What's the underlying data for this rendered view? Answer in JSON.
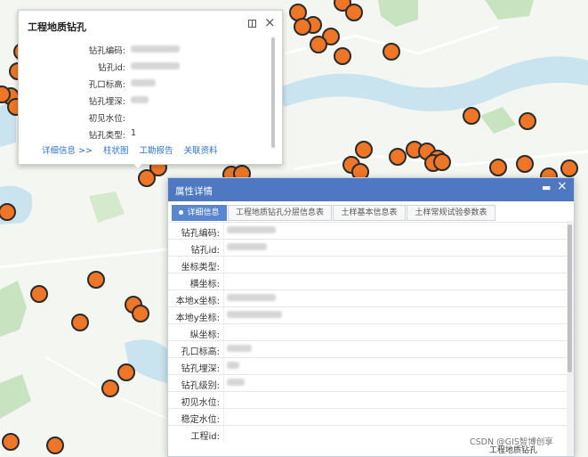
{
  "map": {
    "background": "#f4f6f2",
    "water_color": "#c9e4ee",
    "marker_color": "#ee7626",
    "marker_outline": "#2b2b2b"
  },
  "popup": {
    "title": "工程地质钻孔",
    "rows": [
      {
        "label": "钻孔编码:",
        "value": "",
        "blurred": true
      },
      {
        "label": "钻孔id:",
        "value": "",
        "blurred": true
      },
      {
        "label": "孔口标高:",
        "value": "",
        "blurred": true
      },
      {
        "label": "钻孔埋深:",
        "value": "",
        "blurred": true
      },
      {
        "label": "初见水位:",
        "value": ""
      },
      {
        "label": "钻孔类型:",
        "value": "1"
      }
    ],
    "links": [
      "详细信息 >>",
      "柱状图",
      "工勘报告",
      "关联资料"
    ]
  },
  "panel": {
    "title": "属性详情",
    "tabs": [
      "详细信息",
      "工程地质钻孔分层信息表",
      "土样基本信息表",
      "土样常规试验参数表"
    ],
    "fields": [
      {
        "label": "钻孔编码:",
        "value": "",
        "blurred": true
      },
      {
        "label": "钻孔id:",
        "value": "",
        "blurred": true
      },
      {
        "label": "坐标类型:",
        "value": ""
      },
      {
        "label": "横坐标:",
        "value": ""
      },
      {
        "label": "本地x坐标:",
        "value": "",
        "blurred": true
      },
      {
        "label": "本地y坐标:",
        "value": "",
        "blurred": true
      },
      {
        "label": "纵坐标:",
        "value": ""
      },
      {
        "label": "孔口标高:",
        "value": "",
        "blurred": true
      },
      {
        "label": "钻孔埋深:",
        "value": "",
        "blurred": true
      },
      {
        "label": "钻孔级别:",
        "value": "",
        "blurred": true
      },
      {
        "label": "初见水位:",
        "value": ""
      },
      {
        "label": "稳定水位:",
        "value": ""
      },
      {
        "label": "工程id:",
        "value": ""
      }
    ],
    "accent": "#4e78c2"
  },
  "footer": {
    "layer_name": "工程地质钻孔"
  },
  "watermark": "CSDN @GIS智博创享"
}
